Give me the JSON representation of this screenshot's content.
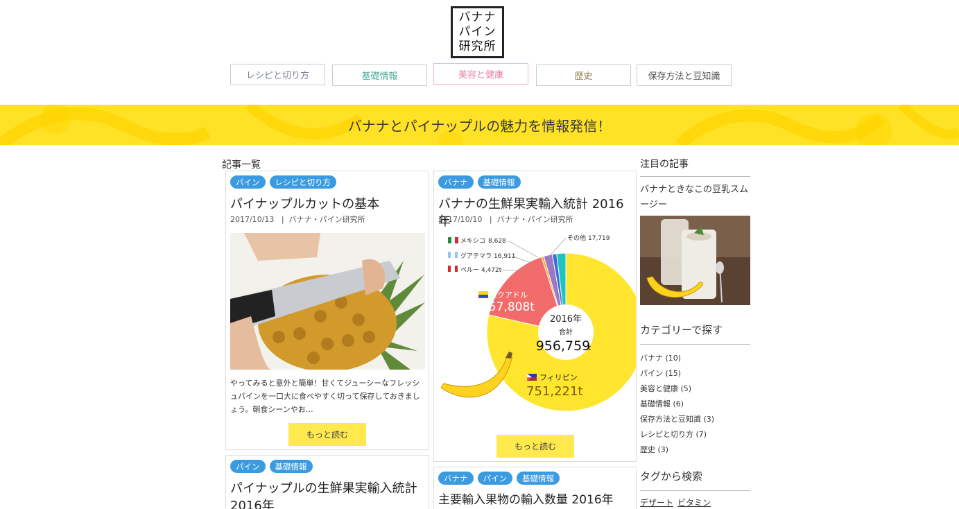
{
  "logo": {
    "line1": "バナナ",
    "line2": "パイン",
    "line3": "研究所"
  },
  "nav": [
    {
      "label": "レシピと切り方",
      "color": "#7a7f9a"
    },
    {
      "label": "基礎情報",
      "color": "#4aab9a"
    },
    {
      "label": "美容と健康",
      "color": "#e87ea0"
    },
    {
      "label": "歴史",
      "color": "#8a7d4a"
    },
    {
      "label": "保存方法と豆知識",
      "color": "#555555"
    }
  ],
  "banner": {
    "text": "バナナとパイナップルの魅力を情報発信！",
    "color": "#ffe225"
  },
  "main": {
    "section_title": "記事一覧",
    "articles": [
      {
        "tags": [
          "パイン",
          "レシピと切り方"
        ],
        "title": "パイナップルカットの基本",
        "date": "2017/10/13",
        "author": "バナナ・パイン研究所",
        "excerpt": "やってみると意外と簡単！甘くてジューシーなフレッシュパインを一口大に食べやすく切って保存しておきましょう。朝食シーンやお…",
        "more": "もっと読む"
      },
      {
        "tags": [
          "バナナ",
          "基礎情報"
        ],
        "title": "バナナの生鮮果実輸入統計 2016年",
        "date": "2017/10/10",
        "author": "バナナ・パイン研究所",
        "more": "もっと読む"
      },
      {
        "tags": [
          "パイン",
          "基礎情報"
        ],
        "title": "パイナップルの生鮮果実輸入統計 2016年"
      },
      {
        "tags": [
          "バナナ",
          "パイン",
          "基礎情報"
        ],
        "title": "主要輸入果物の輸入数量 2016年"
      }
    ]
  },
  "chart_data": {
    "type": "pie",
    "center_year": "2016年",
    "center_label": "合計",
    "center_total": "956,759",
    "center_unit": "t",
    "slices": [
      {
        "label": "フィリピン",
        "value_text": "751,221t",
        "value": 751221,
        "color": "#ffe52e"
      },
      {
        "label": "エクアドル",
        "value_text": "157,808t",
        "value": 157808,
        "color": "#f26b6b"
      },
      {
        "label": "ペルー",
        "value_text": "4,472t",
        "value": 4472,
        "color": "#f5a623"
      },
      {
        "label": "グアテマラ",
        "value_text": "16,911",
        "value": 16911,
        "color": "#9a78c8"
      },
      {
        "label": "メキシコ",
        "value_text": "8,628",
        "value": 8628,
        "color": "#3f6fd0"
      },
      {
        "label": "その他",
        "value_text": "17,719",
        "value": 17719,
        "color": "#22c2c2"
      }
    ]
  },
  "sidebar": {
    "featured_title": "注目の記事",
    "featured_article": "バナナときなこの豆乳スムージー",
    "categories_title": "カテゴリーで探す",
    "categories": [
      "バナナ (10)",
      "パイン (15)",
      "美容と健康 (5)",
      "基礎情報 (6)",
      "保存方法と豆知識 (3)",
      "レシピと切り方 (7)",
      "歴史 (3)"
    ],
    "tags_title": "タグから検索",
    "tags": [
      "デザート",
      "ビタミン"
    ]
  }
}
